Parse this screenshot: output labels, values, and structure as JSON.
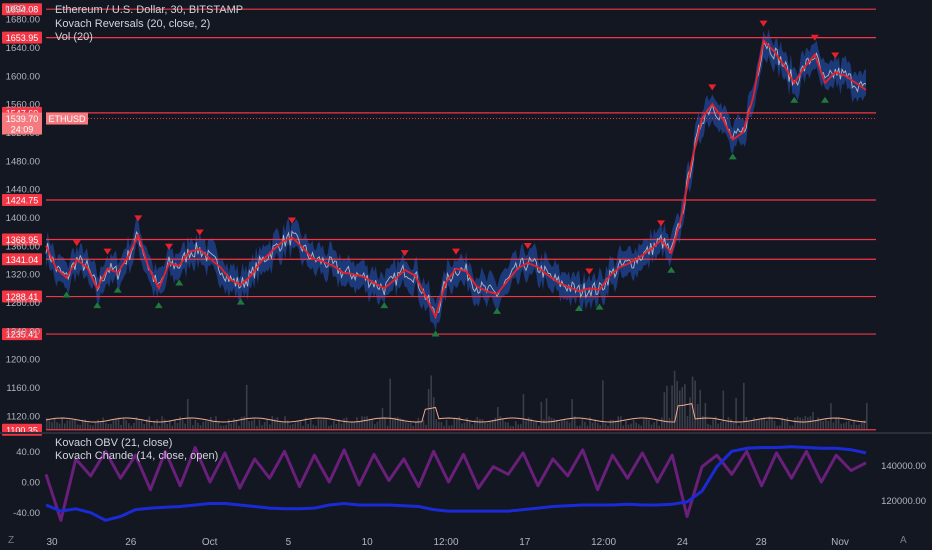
{
  "header": {
    "currency": "USD",
    "symbol_line": "Ethereum / U.S. Dollar, 30, BITSTAMP",
    "indicator1": "Kovach Reversals (20, close, 2)",
    "indicator2": "Vol (20)"
  },
  "lower_pane": {
    "indicator1": "Kovach OBV (21, close)",
    "indicator2": "Kovach Chande (14, close, open)"
  },
  "corner": {
    "left": "Z",
    "right": "A"
  },
  "colors": {
    "background": "#131722",
    "hline": "#f23645",
    "price": "#b2b5be",
    "band": "#1e3f8a",
    "signal": "#e8202a",
    "up_marker": "#1e7a3c",
    "down_marker": "#e8202a",
    "obv": "#1a2bd6",
    "chande": "#6a1f7a",
    "volume": "#3a3e48",
    "volume_ma": "#f7a98f"
  },
  "chart_data": [
    {
      "type": "line",
      "title": "Ethereum / U.S. Dollar, 30, BITSTAMP",
      "ylabel": "USD",
      "ylim": [
        1100,
        1700
      ],
      "grid": false,
      "x_tick_labels": [
        "30",
        "26",
        "Oct",
        "5",
        "10",
        "12:00",
        "17",
        "12:00",
        "24",
        "28",
        "Nov"
      ],
      "y_tick_labels": [
        "1680.00",
        "1640.00",
        "1600.00",
        "1560.00",
        "1520.00",
        "1480.00",
        "1440.00",
        "1400.00",
        "1360.00",
        "1320.00",
        "1280.00",
        "1240.00",
        "1200.00",
        "1160.00",
        "1120.00"
      ],
      "horizontal_levels": [
        1694.08,
        1653.95,
        1547.69,
        1424.75,
        1368.95,
        1341.04,
        1288.41,
        1235.41,
        1100.35
      ],
      "level_labels": [
        "1694.08",
        "1653.95",
        "1547.69",
        "1424.75",
        "1368.95",
        "1341.04",
        "1288.41",
        "1235.41",
        "1100.35"
      ],
      "last_price": {
        "value": 1539.7,
        "label": "1539.70",
        "symbol": "ETHUSD",
        "countdown": "24:09"
      },
      "series": [
        {
          "x": [
            0,
            3,
            6,
            9,
            12,
            15,
            18,
            21,
            24,
            27,
            30,
            33,
            36,
            39,
            42,
            45,
            48,
            51,
            54,
            57,
            60,
            63,
            66,
            69,
            72,
            75,
            78,
            81,
            84,
            87,
            90,
            93,
            96,
            99,
            102,
            105,
            108,
            111,
            114,
            117,
            120,
            123,
            126,
            129,
            132,
            135,
            138,
            141,
            144,
            147,
            150,
            153,
            156,
            159,
            162,
            165,
            168,
            171,
            174,
            177,
            180,
            183,
            186,
            189,
            192,
            195,
            198,
            201,
            204,
            207,
            210
          ],
          "values": [
            1360,
            1328,
            1315,
            1340,
            1330,
            1300,
            1328,
            1322,
            1345,
            1375,
            1330,
            1300,
            1335,
            1332,
            1352,
            1355,
            1342,
            1330,
            1312,
            1305,
            1318,
            1338,
            1352,
            1365,
            1372,
            1358,
            1342,
            1338,
            1332,
            1322,
            1320,
            1316,
            1308,
            1300,
            1312,
            1326,
            1318,
            1290,
            1260,
            1308,
            1328,
            1324,
            1303,
            1296,
            1292,
            1310,
            1328,
            1336,
            1330,
            1318,
            1308,
            1302,
            1296,
            1300,
            1298,
            1318,
            1330,
            1336,
            1345,
            1355,
            1368,
            1350,
            1400,
            1480,
            1540,
            1560,
            1540,
            1510,
            1520,
            1570,
            1650
          ]
        },
        {
          "x": [
            210,
            213,
            216,
            219,
            222,
            225,
            228,
            231,
            234,
            237,
            240
          ],
          "values": [
            1650,
            1635,
            1615,
            1590,
            1612,
            1630,
            1590,
            1605,
            1600,
            1590,
            1580
          ]
        }
      ]
    },
    {
      "type": "line",
      "title": "Kovach OBV (21, close)",
      "ylim": [
        -60,
        60
      ],
      "y_tick_labels": [
        "40.00",
        "0.00",
        "-40.00"
      ],
      "right_tick_labels": [
        "140000.00",
        "120000.00"
      ],
      "series": [
        {
          "values": [
            -30,
            -38,
            -35,
            -40,
            -50,
            -45,
            -36,
            -34,
            -33,
            -32,
            -30,
            -28,
            -28,
            -30,
            -32,
            -34,
            -35,
            -35,
            -34,
            -30,
            -28,
            -30,
            -30,
            -30,
            -31,
            -32,
            -36,
            -38,
            -38,
            -38,
            -38,
            -38,
            -36,
            -34,
            -32,
            -31,
            -30,
            -30,
            -30,
            -29,
            -30,
            -30,
            -29,
            -26,
            -12,
            20,
            40,
            44,
            45,
            45,
            46,
            45,
            44,
            44,
            42,
            38
          ]
        },
        {
          "values": [
            10,
            -50,
            30,
            8,
            40,
            5,
            35,
            -10,
            40,
            -5,
            45,
            0,
            38,
            -8,
            30,
            5,
            40,
            -6,
            35,
            0,
            42,
            -4,
            36,
            2,
            30,
            -6,
            40,
            0,
            36,
            -8,
            20,
            10,
            38,
            -5,
            30,
            8,
            42,
            -10,
            35,
            5,
            38,
            0,
            35,
            -45,
            20,
            35,
            10,
            40,
            -5,
            38,
            5,
            40,
            0,
            35,
            15,
            25
          ]
        }
      ]
    }
  ]
}
